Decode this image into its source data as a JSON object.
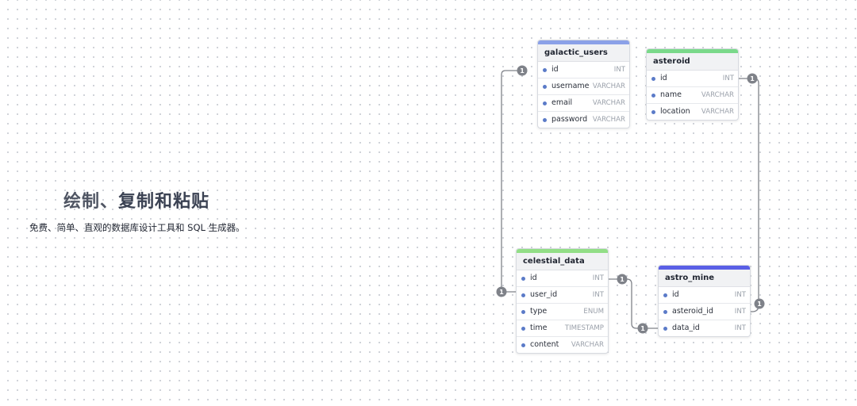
{
  "hero": {
    "title_part1": "绘制、",
    "title_part2": "复制和粘贴",
    "subtitle": "免费、简单、直观的数据库设计工具和 SQL 生成器。"
  },
  "tables": {
    "galactic_users": {
      "name": "galactic_users",
      "color": "#8ba1e8",
      "fields": [
        {
          "name": "id",
          "type": "INT"
        },
        {
          "name": "username",
          "type": "VARCHAR"
        },
        {
          "name": "email",
          "type": "VARCHAR"
        },
        {
          "name": "password",
          "type": "VARCHAR"
        }
      ]
    },
    "asteroid": {
      "name": "asteroid",
      "color": "#7ad98a",
      "fields": [
        {
          "name": "id",
          "type": "INT"
        },
        {
          "name": "name",
          "type": "VARCHAR"
        },
        {
          "name": "location",
          "type": "VARCHAR"
        }
      ]
    },
    "celestial_data": {
      "name": "celestial_data",
      "color": "#92de86",
      "fields": [
        {
          "name": "id",
          "type": "INT"
        },
        {
          "name": "user_id",
          "type": "INT"
        },
        {
          "name": "type",
          "type": "ENUM"
        },
        {
          "name": "time",
          "type": "TIMESTAMP"
        },
        {
          "name": "content",
          "type": "VARCHAR"
        }
      ]
    },
    "astro_mine": {
      "name": "astro_mine",
      "color": "#5a5fe6",
      "fields": [
        {
          "name": "id",
          "type": "INT"
        },
        {
          "name": "asteroid_id",
          "type": "INT"
        },
        {
          "name": "data_id",
          "type": "INT"
        }
      ]
    }
  },
  "cardinality_label": "1",
  "colors": {
    "relationship_line": "#7f8289",
    "field_dot": "#5b7bc8"
  }
}
